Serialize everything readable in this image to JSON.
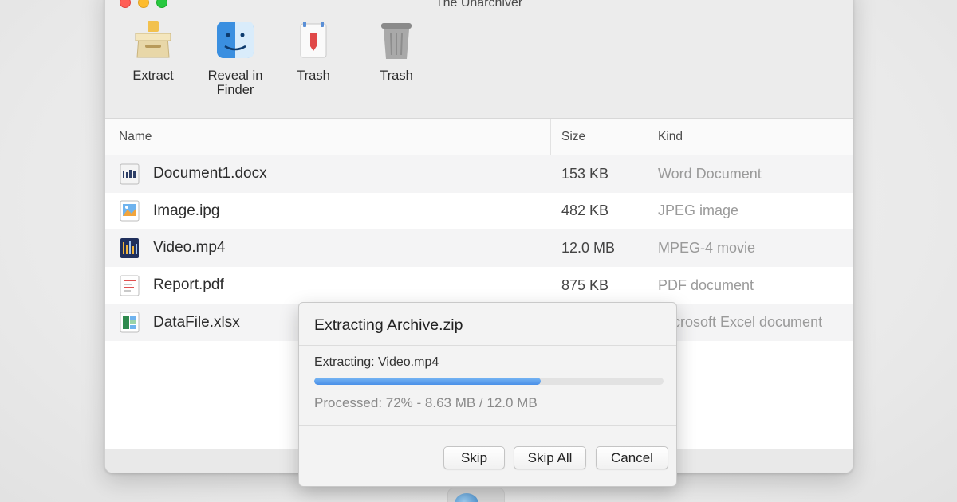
{
  "window": {
    "title": "The Unarchiver"
  },
  "toolbar": {
    "items": [
      {
        "label": "Extract",
        "icon": "extract-box-icon"
      },
      {
        "label": "Reveal in\nFinder",
        "icon": "finder-icon"
      },
      {
        "label": "Trash",
        "icon": "trash-marked-icon"
      },
      {
        "label": "Trash",
        "icon": "trash-can-icon"
      }
    ]
  },
  "list": {
    "columns": {
      "name": "Name",
      "size": "Size",
      "kind": "Kind"
    },
    "rows": [
      {
        "name": "Document1.docx",
        "size": "153 KB",
        "kind": "Word Document",
        "icon": "word-doc-icon"
      },
      {
        "name": "Image.ipg",
        "size": "482 KB",
        "kind": "JPEG image",
        "icon": "image-file-icon"
      },
      {
        "name": "Video.mp4",
        "size": "12.0 MB",
        "kind": "MPEG-4 movie",
        "icon": "video-file-icon"
      },
      {
        "name": "Report.pdf",
        "size": "875 KB",
        "kind": "PDF document",
        "icon": "pdf-file-icon"
      },
      {
        "name": "DataFile.xlsx",
        "size": "",
        "kind": "Microsoft Excel document",
        "icon": "excel-file-icon"
      }
    ]
  },
  "dialog": {
    "title": "Extracting Archive.zip",
    "current_file": "Extracting: Video.mp4",
    "progress_percent": 72,
    "processed": "Processed: 72% - 8.63 MB / 12.0 MB",
    "buttons": {
      "skip": "Skip",
      "skip_all": "Skip All",
      "cancel": "Cancel"
    }
  },
  "colors": {
    "accent": "#4a90e8",
    "row_alt": "#f4f4f5"
  }
}
